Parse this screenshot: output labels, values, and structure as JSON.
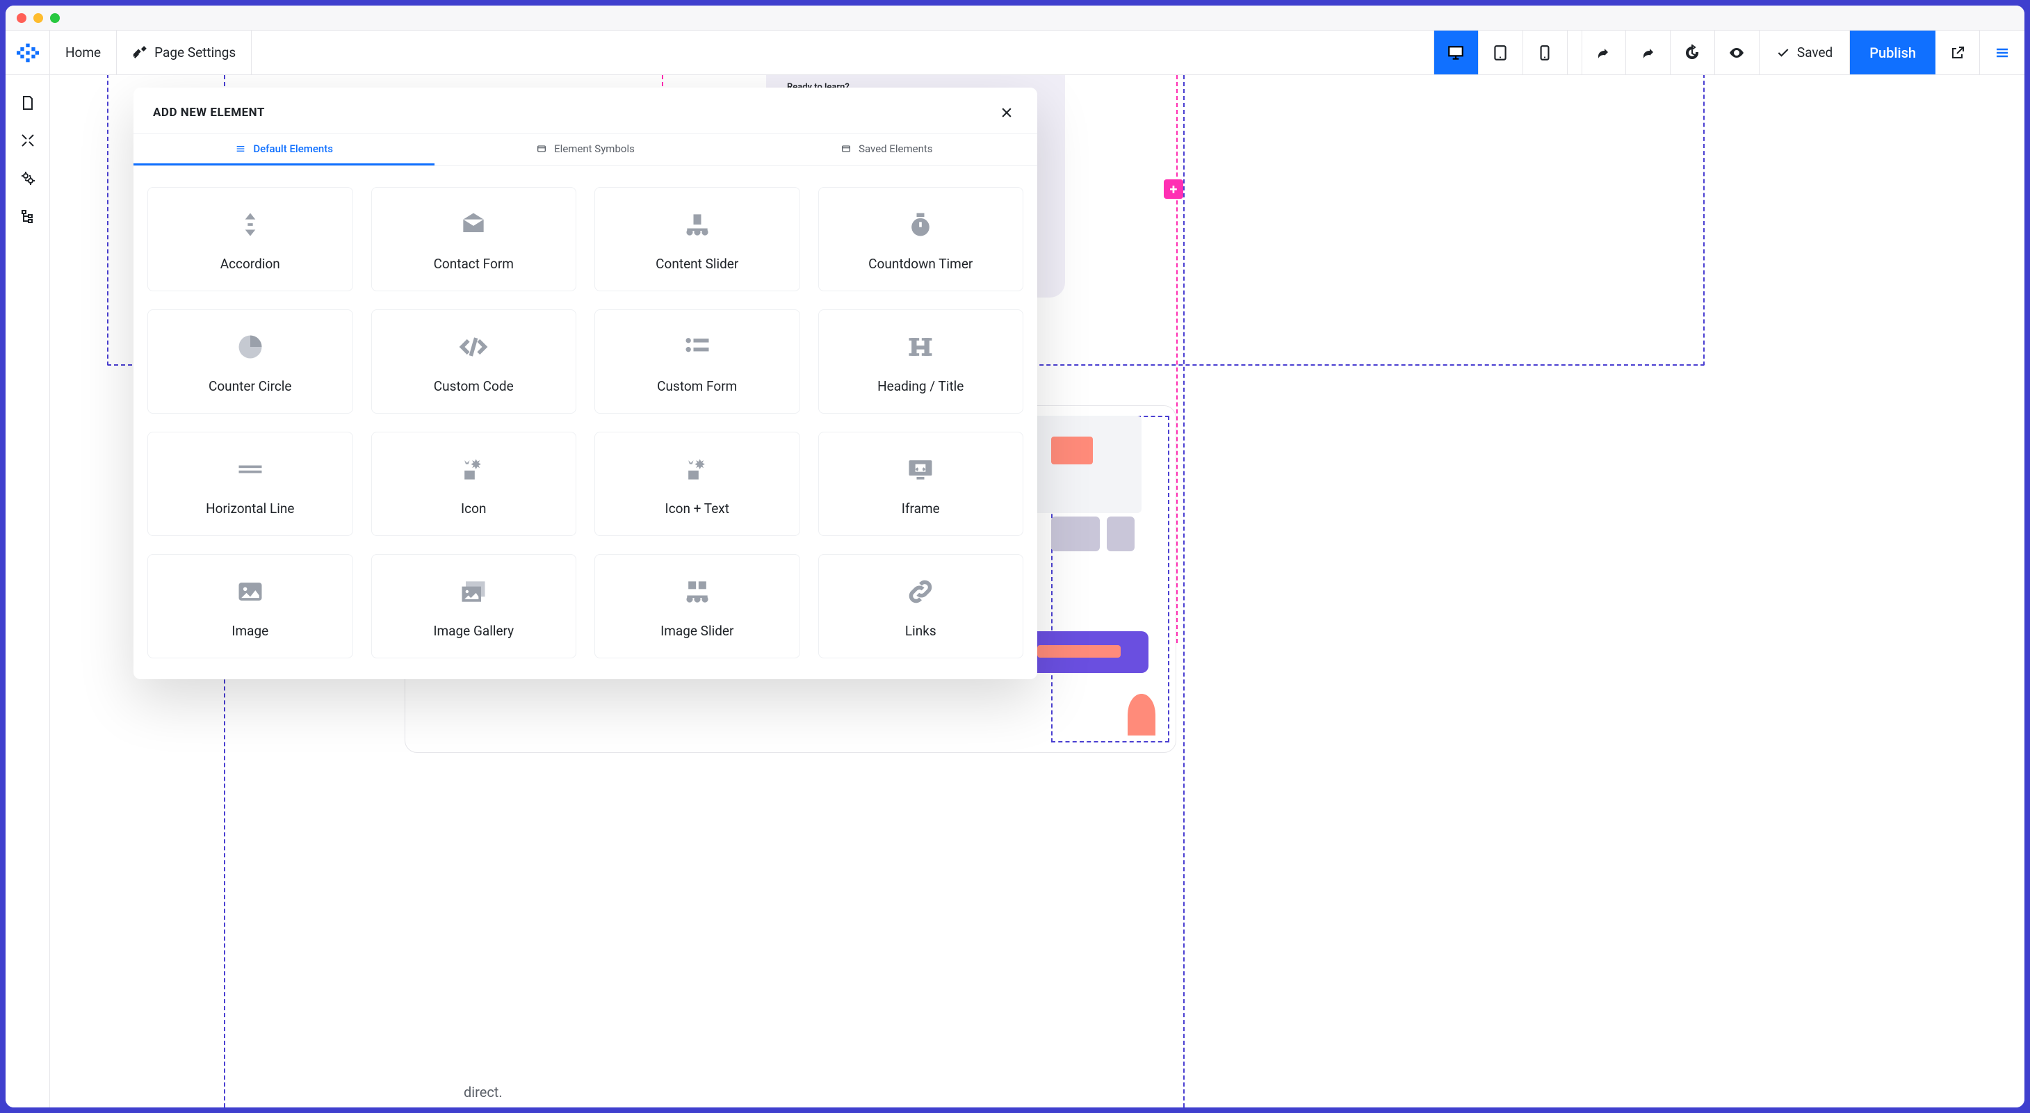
{
  "toolbar": {
    "home": "Home",
    "page_settings": "Page Settings",
    "saved": "Saved",
    "publish": "Publish"
  },
  "canvas": {
    "ready_label": "Ready to learn?",
    "direct": "direct."
  },
  "modal": {
    "title": "ADD NEW ELEMENT",
    "tabs": {
      "default": "Default Elements",
      "symbols": "Element Symbols",
      "saved": "Saved Elements"
    },
    "elements": {
      "accordion": "Accordion",
      "contact_form": "Contact Form",
      "content_slider": "Content Slider",
      "countdown_timer": "Countdown Timer",
      "counter_circle": "Counter Circle",
      "custom_code": "Custom Code",
      "custom_form": "Custom Form",
      "heading_title": "Heading / Title",
      "horizontal_line": "Horizontal Line",
      "icon": "Icon",
      "icon_text": "Icon + Text",
      "iframe": "Iframe",
      "image": "Image",
      "image_gallery": "Image Gallery",
      "image_slider": "Image Slider",
      "links": "Links"
    }
  }
}
